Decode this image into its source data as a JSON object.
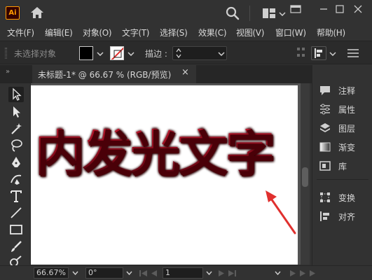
{
  "app": {
    "logo_text": "Ai"
  },
  "menu": [
    "文件(F)",
    "编辑(E)",
    "对象(O)",
    "文字(T)",
    "选择(S)",
    "效果(C)",
    "视图(V)",
    "窗口(W)",
    "帮助(H)"
  ],
  "control_bar": {
    "selection_status": "未选择对象",
    "stroke_label": "描边 :",
    "stroke_value": ""
  },
  "document_tab": {
    "title": "未标题-1* @ 66.67 % (RGB/预览)",
    "close_glyph": "×"
  },
  "artboard": {
    "text": "内发光文字",
    "text_color": "#9c1022"
  },
  "right_panel": {
    "items": [
      {
        "label": "注释",
        "icon": "comment-icon"
      },
      {
        "label": "属性",
        "icon": "properties-icon"
      },
      {
        "label": "图层",
        "icon": "layers-icon"
      },
      {
        "label": "渐变",
        "icon": "gradient-icon"
      },
      {
        "label": "库",
        "icon": "libraries-icon"
      },
      {
        "label": "变换",
        "icon": "transform-icon"
      },
      {
        "label": "对齐",
        "icon": "align-icon"
      }
    ]
  },
  "status_bar": {
    "zoom": "66.67%",
    "rotation": "0°",
    "artboard_number": "1"
  },
  "colors": {
    "ui_dark": "#323232",
    "control_bar": "#2b2b2b",
    "annotation_arrow": "#e0302e",
    "logo_accent": "#ff9a00"
  }
}
